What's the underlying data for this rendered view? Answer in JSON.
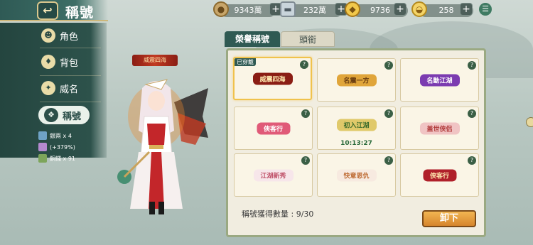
{
  "header": {
    "back_icon": "back-arrow-icon",
    "title": "稱號"
  },
  "currencies": [
    {
      "name": "copper",
      "icon": "copper-coin-icon",
      "value": "9343萬"
    },
    {
      "name": "silver",
      "icon": "silver-ingot-icon",
      "value": "232萬"
    },
    {
      "name": "gold",
      "icon": "gold-ingot-icon",
      "value": "9736"
    },
    {
      "name": "yuanbao",
      "icon": "yuanbao-icon",
      "value": "258"
    }
  ],
  "nav": {
    "items": [
      {
        "label": "角色",
        "icon": "character-icon"
      },
      {
        "label": "背包",
        "icon": "bag-icon"
      },
      {
        "label": "威名",
        "icon": "fame-icon"
      },
      {
        "label": "稱號",
        "icon": "title-icon",
        "active": true
      }
    ]
  },
  "stats": [
    {
      "label": "銀兩 x 4",
      "color": "#6fa3c6"
    },
    {
      "label": "(+379%)",
      "color": "#b48acf"
    },
    {
      "label": "銅錢 x 91",
      "color": "#7da55b"
    }
  ],
  "character": {
    "title_label": "威震四海"
  },
  "panel": {
    "tabs": [
      {
        "label": "榮譽稱號",
        "active": true
      },
      {
        "label": "頭銜",
        "active": false
      }
    ],
    "cards": [
      {
        "emblem": "威震四海",
        "equipped": true,
        "equipped_label": "已穿戴",
        "colors": [
          "#8a1d14",
          "#ffe9b0"
        ]
      },
      {
        "emblem": "名震一方",
        "equipped": false,
        "colors": [
          "#e0a53a",
          "#6a3d10"
        ]
      },
      {
        "emblem": "名動江湖",
        "equipped": false,
        "colors": [
          "#7b3bb0",
          "#ffffff"
        ]
      },
      {
        "emblem": "俠客行",
        "equipped": false,
        "colors": [
          "#e05a78",
          "#ffffff"
        ]
      },
      {
        "emblem": "初入江湖",
        "equipped": false,
        "timer": "10:13:27",
        "colors": [
          "#e0c96a",
          "#3a6b2a"
        ]
      },
      {
        "emblem": "盖世侠侣",
        "equipped": false,
        "colors": [
          "#f0c4c4",
          "#b13a3a"
        ]
      },
      {
        "emblem": "江湖新秀",
        "equipped": false,
        "colors": [
          "#f7e6ea",
          "#c0526a"
        ]
      },
      {
        "emblem": "快意恩仇",
        "equipped": false,
        "colors": [
          "#f7eae0",
          "#c0703a"
        ]
      },
      {
        "emblem": "侠客行",
        "equipped": false,
        "colors": [
          "#b0202a",
          "#ffe9b0"
        ]
      }
    ],
    "count_label": "稱號獲得數量 : 9/30",
    "unequip_label": "卸下"
  }
}
